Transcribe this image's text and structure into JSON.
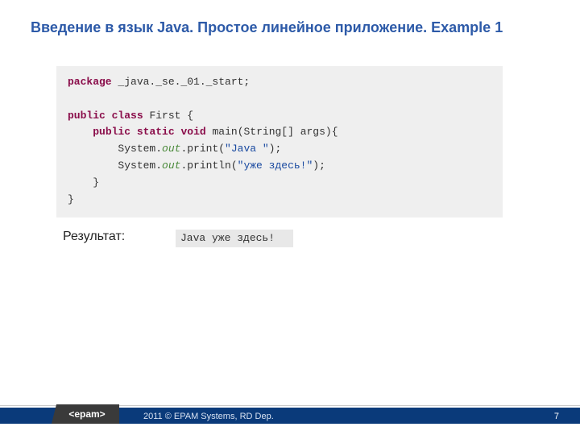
{
  "title": "Введение в язык Java. Простое линейное приложение. Example 1",
  "code": {
    "kw_package": "package",
    "pkg_name": " _java._se._01._start;",
    "kw_public1": "public",
    "kw_class": "class",
    "cls_name": " First {",
    "kw_public2": "public",
    "kw_static": "static",
    "kw_void": "void",
    "main_sig": " main(String[] args){",
    "sys1": "        System.",
    "out": "out",
    "print_call": ".print(",
    "str1": "\"Java \"",
    "close1": ");",
    "sys2": "        System.",
    "println_call": ".println(",
    "str2": "\"уже здесь!\"",
    "close2": ");",
    "brace1": "    }",
    "brace2": "}"
  },
  "result_label": "Результат:",
  "result_output": "Java уже здесь!",
  "footer": {
    "logo_text": "<epam>",
    "copyright": "2011 © EPAM Systems, RD Dep.",
    "page": "7"
  }
}
